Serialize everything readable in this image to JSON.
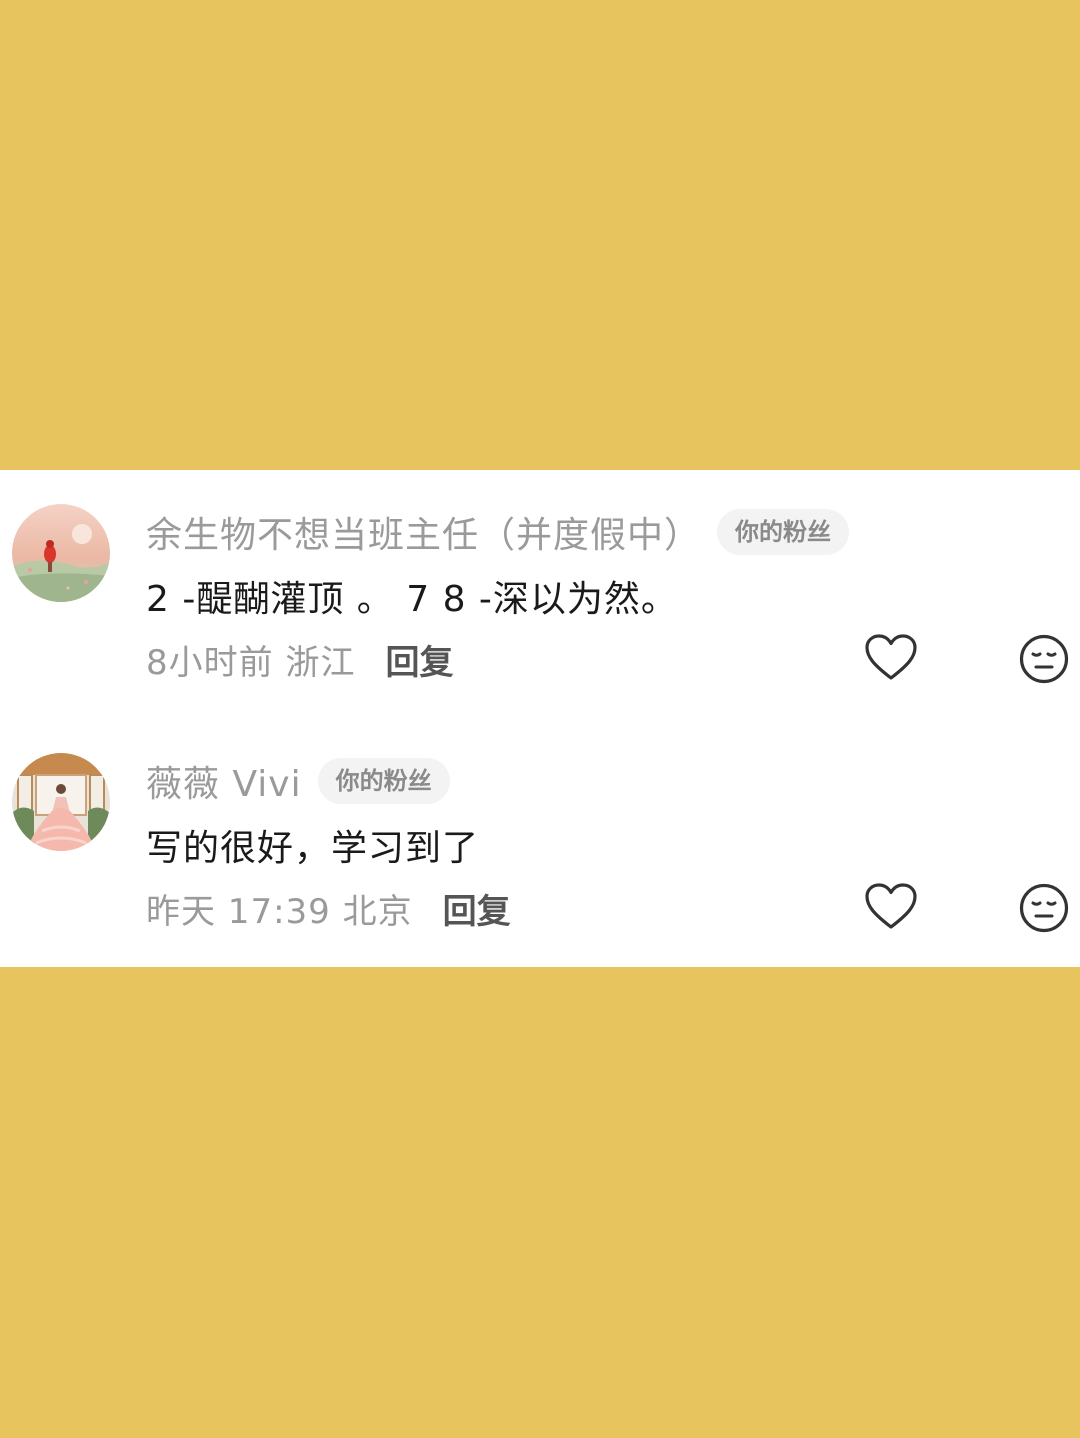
{
  "comments": [
    {
      "username": "余生物不想当班主任（并度假中）",
      "badge": "你的粉丝",
      "text": "2 -醍醐灌顶 。 7 8 -深以为然。",
      "meta": "8小时前 浙江",
      "reply_label": "回复",
      "avatar_icon": "avatar-illustration-icon"
    },
    {
      "username": "薇薇 Vivi",
      "badge": "你的粉丝",
      "text": "写的很好，学习到了",
      "meta": "昨天 17:39 北京",
      "reply_label": "回复",
      "avatar_icon": "avatar-photo-icon"
    }
  ],
  "colors": {
    "background": "#E8C45F",
    "panel": "#FFFFFF",
    "muted_text": "#9A9A9A",
    "main_text": "#1A1A1A",
    "badge_bg": "#F3F3F3"
  },
  "icons": {
    "like": "heart-outline-icon",
    "dislike": "neutral-face-icon"
  }
}
